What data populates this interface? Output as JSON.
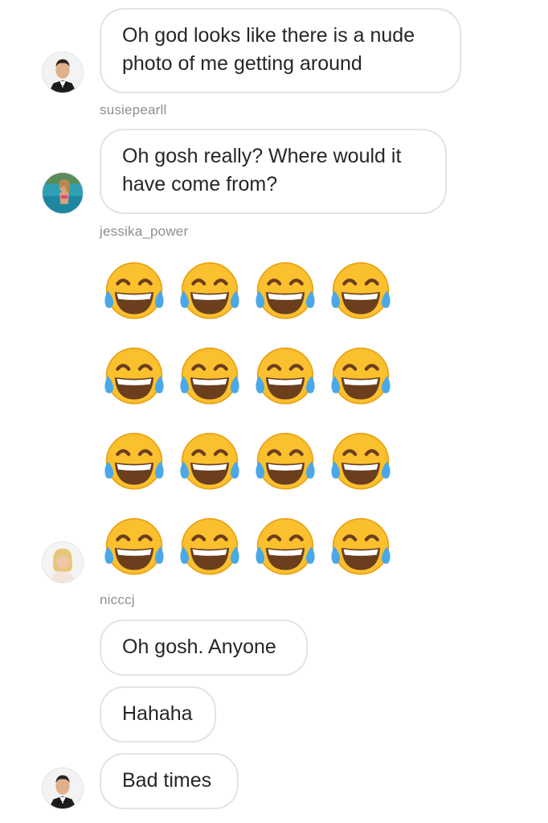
{
  "messages": [
    {
      "text_line1": "Oh god looks like there is a nude",
      "text_line2": "photo of me getting around"
    },
    {
      "username": "susiepearll",
      "text_line1": "Oh gosh really? Where would it",
      "text_line2": "have come from?"
    },
    {
      "username": "jessika_power",
      "emoji": "face-with-tears-of-joy",
      "emoji_count": 16
    },
    {
      "username": "nicccj",
      "text": "Oh gosh. Anyone"
    },
    {
      "text": "Hahaha"
    },
    {
      "text": "Bad times"
    }
  ],
  "avatars": {
    "sender1": "man-in-tuxedo-avatar",
    "susiepearll": "woman-in-pool-avatar",
    "jessika_power": "blonde-woman-avatar"
  },
  "colors": {
    "bubble_border": "#e3e3e3",
    "text": "#262626",
    "username": "#8e8e8e",
    "emoji_face": "#fbc02d"
  }
}
